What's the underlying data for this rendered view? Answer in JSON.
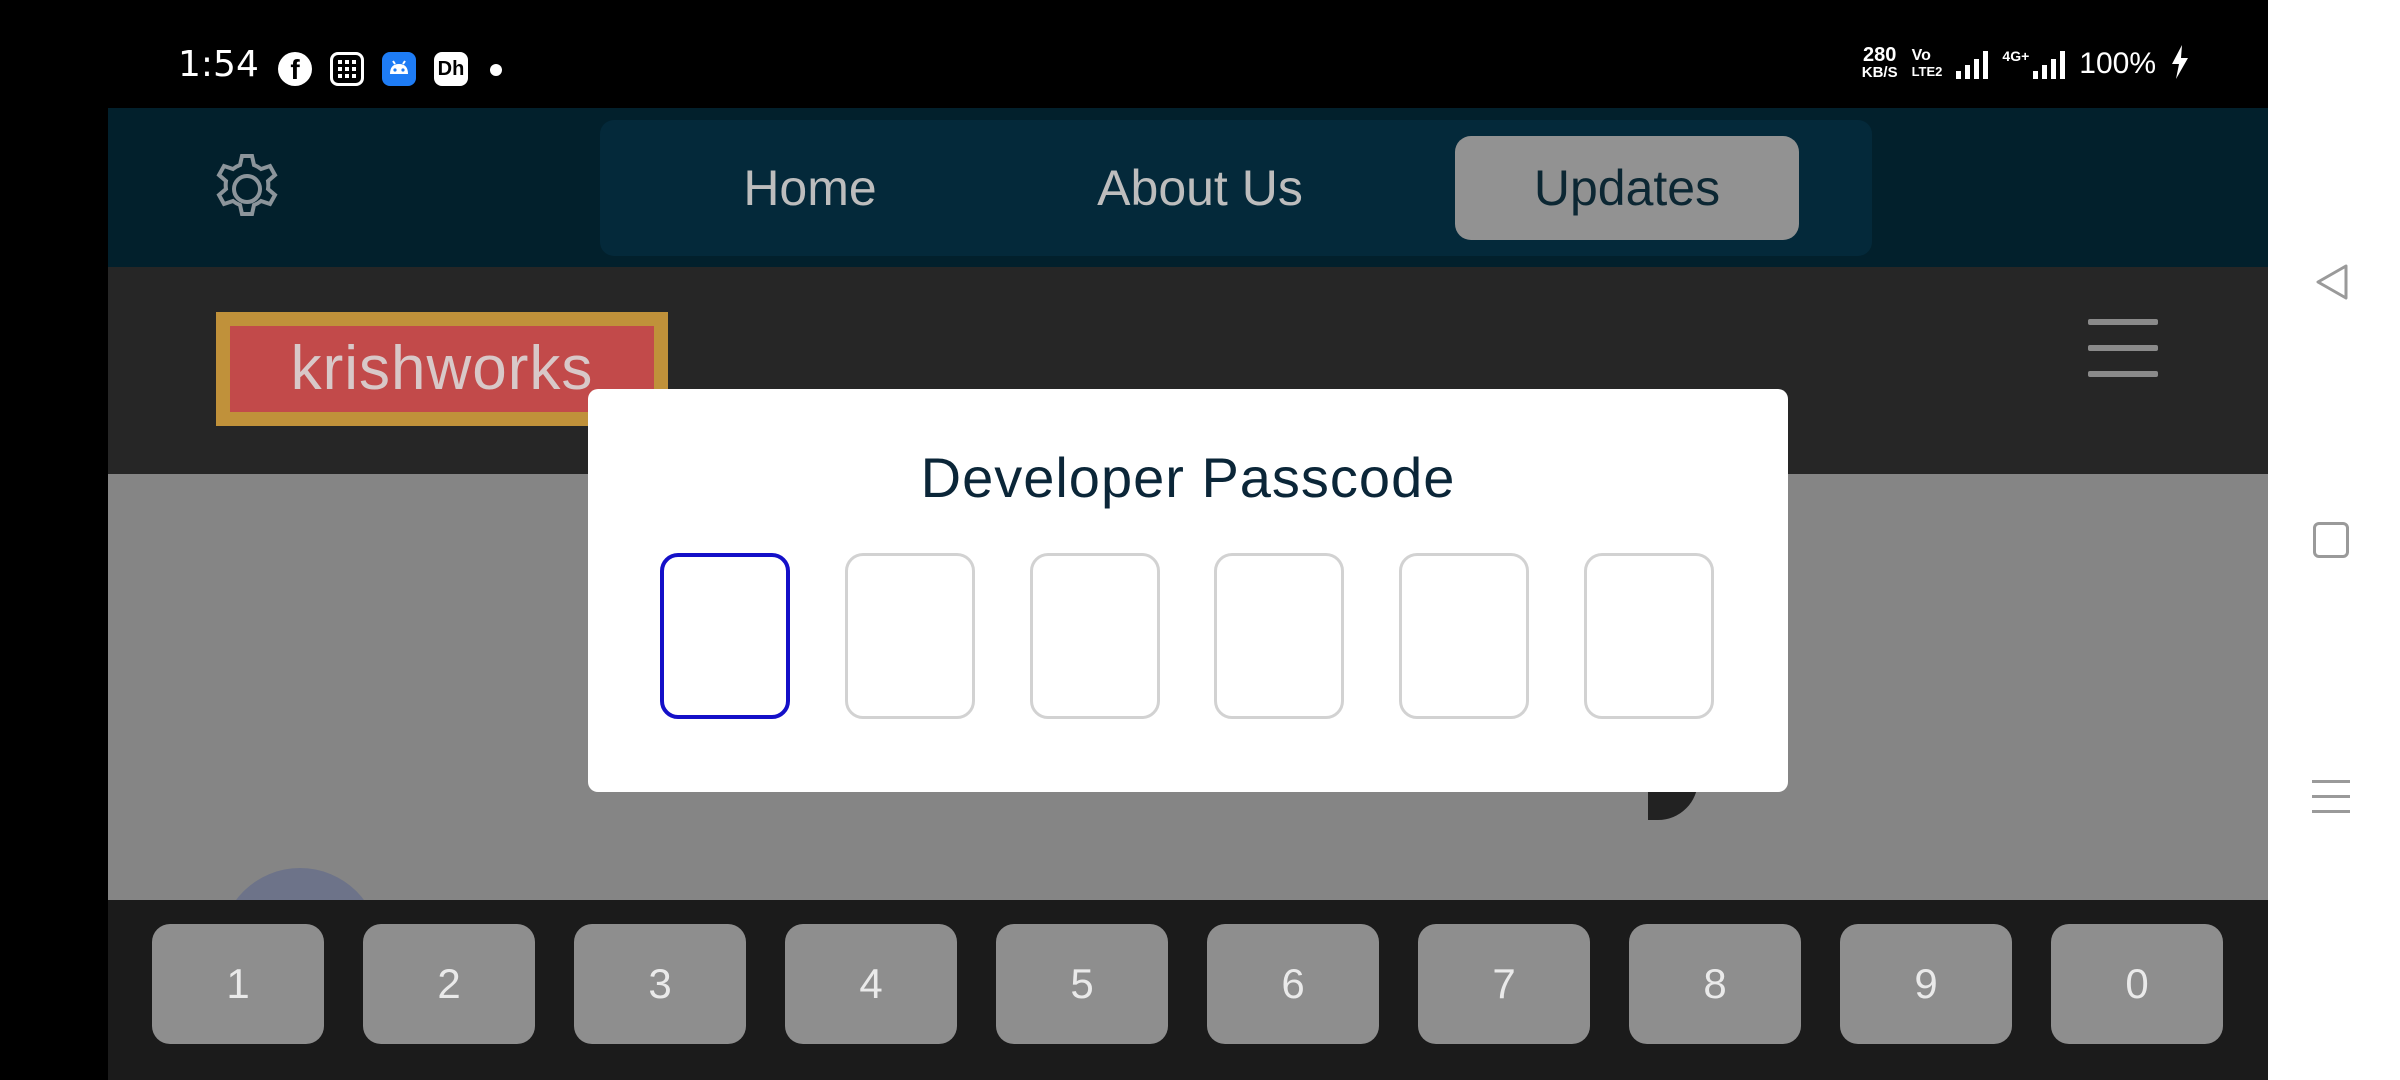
{
  "status_bar": {
    "time": "1:54",
    "net_speed_value": "280",
    "net_speed_unit": "KB/S",
    "volte_line1": "Vo",
    "volte_line2": "LTE2",
    "network_type": "4G+",
    "battery": "100%",
    "notification_icons": [
      "facebook-icon",
      "calculator-icon",
      "android-icon",
      "dh-app-icon"
    ],
    "colors": {
      "android_icon_bg": "#1e7cf5"
    }
  },
  "top_nav": {
    "settings_icon": "gear-icon",
    "tabs": [
      {
        "label": "Home",
        "active": false
      },
      {
        "label": "About Us",
        "active": false
      },
      {
        "label": "Updates",
        "active": true
      }
    ]
  },
  "header": {
    "logo_text": "krishworks",
    "menu_icon": "hamburger-icon"
  },
  "modal": {
    "title": "Developer Passcode",
    "digit_count": 6,
    "active_digit": 1,
    "colors": {
      "active_border": "#1410c8"
    }
  },
  "keypad": {
    "keys": [
      "1",
      "2",
      "3",
      "4",
      "5",
      "6",
      "7",
      "8",
      "9",
      "0"
    ]
  },
  "system_nav": {
    "icons": [
      "back-icon",
      "home-icon",
      "recents-icon"
    ]
  },
  "colors": {
    "nav_bg": "#02202c",
    "nav_pill_bg": "#04293a",
    "header_bg": "#262626",
    "page_bg": "#858585",
    "keypad_bg": "#1b1b1b",
    "key_bg": "#8e8e8e",
    "logo_bg": "#c24a4a",
    "logo_border": "#c0913a"
  }
}
